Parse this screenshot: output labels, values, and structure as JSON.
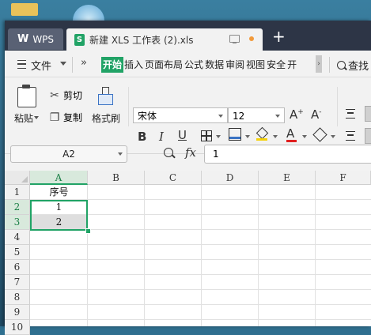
{
  "titlebar": {
    "app_tab_label": "WPS",
    "doc_tab_title": "新建 XLS 工作表 (2).xls",
    "doc_icon": "S",
    "new_tab_label": "+"
  },
  "menu": {
    "file_label": "文件",
    "more_label": "»",
    "tabs": [
      "开始",
      "插入",
      "页面布局",
      "公式",
      "数据",
      "审阅",
      "视图",
      "安全",
      "开"
    ],
    "active_tab": "开始",
    "search_label": "查找"
  },
  "toolbar": {
    "paste_label": "粘贴",
    "cut_label": "剪切",
    "copy_label": "复制",
    "format_painter_label": "格式刷",
    "font_name": "宋体",
    "font_size": "12",
    "bold": "B",
    "italic": "I",
    "underline": "U",
    "grow_font": "A+",
    "shrink_font": "A-",
    "font_color_glyph": "A"
  },
  "formula": {
    "name_box": "A2",
    "fx_label": "fx",
    "value": "1"
  },
  "sheet": {
    "columns": [
      "A",
      "B",
      "C",
      "D",
      "E",
      "F"
    ],
    "rows": [
      "1",
      "2",
      "3",
      "4",
      "5",
      "6",
      "7",
      "8",
      "9",
      "10"
    ],
    "cells": {
      "A1": "序号",
      "A2": "1",
      "A3": "2"
    },
    "selection": "A2:A3",
    "accent": "#21a366"
  }
}
